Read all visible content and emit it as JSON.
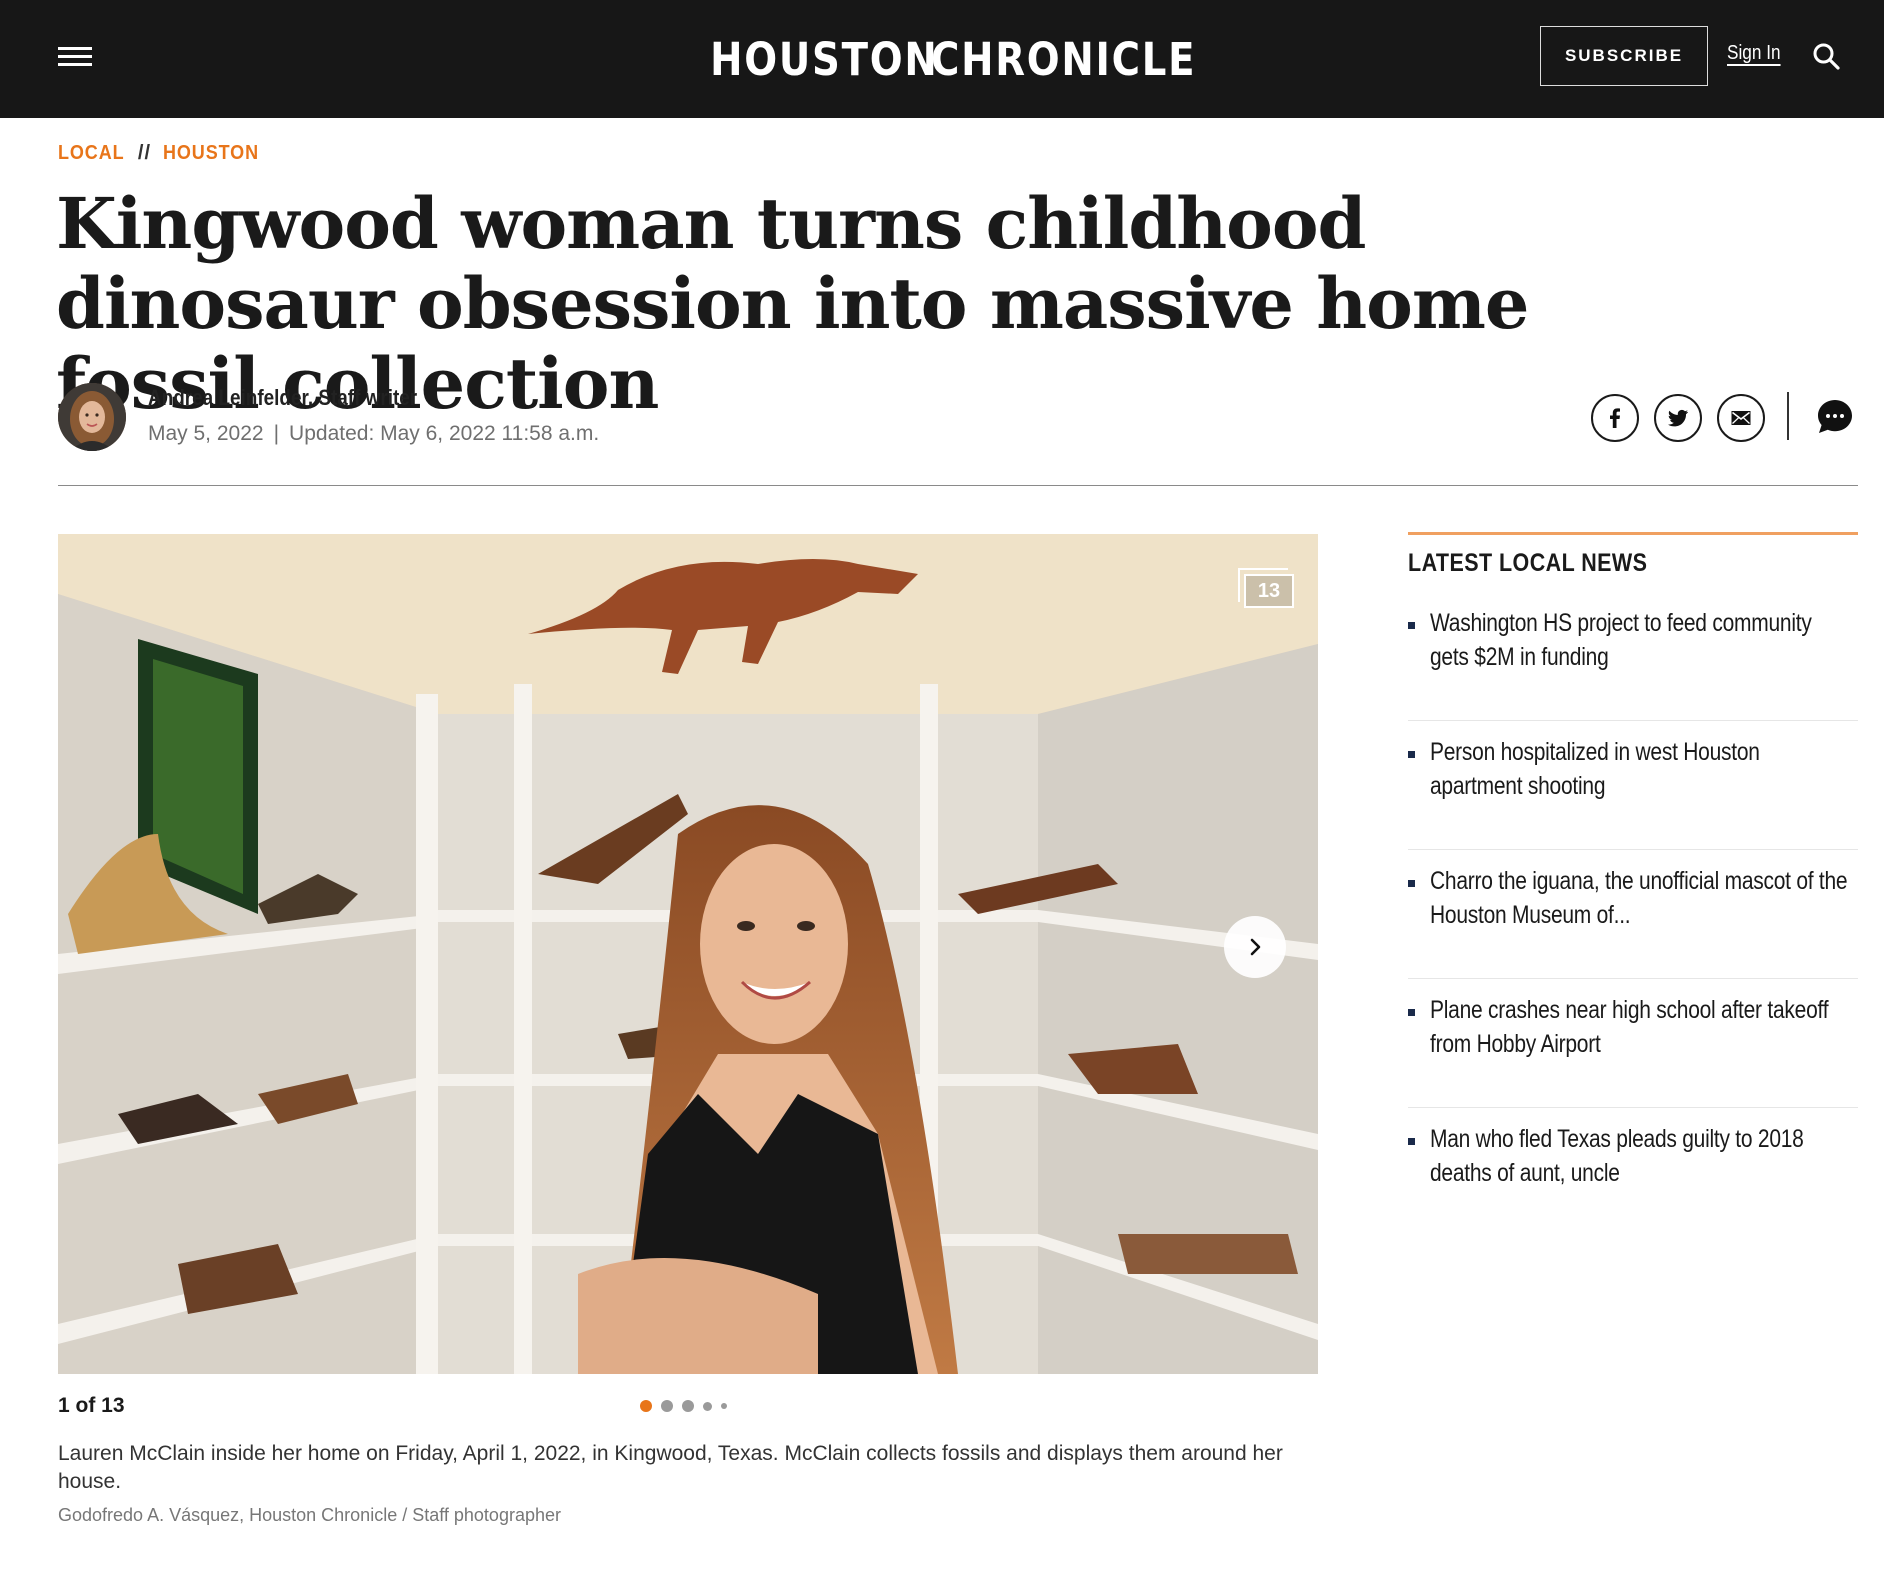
{
  "header": {
    "logo_left": "HOUSTON",
    "logo_right": "CHRONICLE",
    "subscribe_label": "SUBSCRIBE",
    "signin_label": "Sign In",
    "icons": [
      "hamburger-menu-icon",
      "star-logo-icon",
      "search-icon"
    ]
  },
  "breadcrumb": {
    "section": "LOCAL",
    "separator": "//",
    "subsection": "HOUSTON"
  },
  "article": {
    "headline": "Kingwood woman turns childhood dinosaur obsession into massive home fossil collection",
    "author": "Andrea Leinfelder, Staff writer",
    "published": "May 5, 2022",
    "date_separator": "|",
    "updated": "Updated: May 6, 2022 11:58 a.m."
  },
  "share": {
    "icons": [
      "facebook-icon",
      "twitter-icon",
      "email-icon",
      "comment-icon"
    ]
  },
  "gallery": {
    "photo_count": "13",
    "position_label": "1 of 13",
    "dots": 5,
    "active_dot": 0,
    "caption": "Lauren McClain inside her home on Friday, April 1, 2022, in Kingwood, Texas. McClain collects fossils and displays them around her house.",
    "credit": "Godofredo A. Vásquez, Houston Chronicle / Staff photographer"
  },
  "sidebar": {
    "title": "LATEST LOCAL NEWS",
    "items": [
      {
        "title": "Washington HS project to feed community gets $2M in funding"
      },
      {
        "title": "Person hospitalized in west Houston apartment shooting"
      },
      {
        "title": "Charro the iguana, the unofficial mascot of the Houston Museum of..."
      },
      {
        "title": "Plane crashes near high school after takeoff from Hobby Airport"
      },
      {
        "title": "Man who fled Texas pleads guilty to 2018 deaths of aunt, uncle"
      }
    ]
  },
  "colors": {
    "topbar": "#171717",
    "accent_orange": "#e8751a",
    "logo_star": "#e8b73a"
  }
}
